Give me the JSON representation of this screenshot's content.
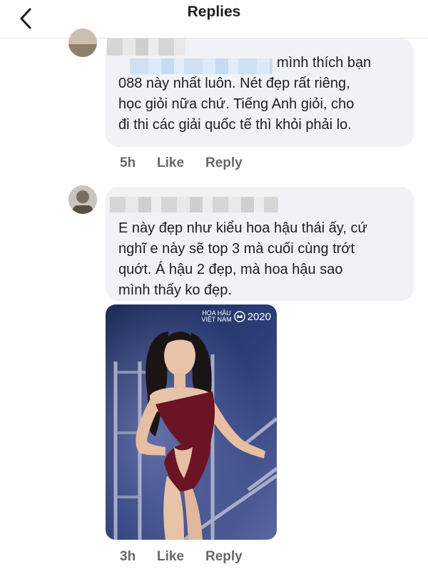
{
  "header": {
    "title": "Replies",
    "back_icon": "chevron-left-icon"
  },
  "comments": [
    {
      "author_visible": "",
      "text": " mình thích bạn\n088 này nhất luôn. Nét đẹp rất riêng,\nhọc giỏi nữa chứ. Tiếng Anh giỏi, cho\nđi thi các giải quốc tế thì khỏi phải lo.",
      "time": "5h",
      "like_label": "Like",
      "reply_label": "Reply"
    },
    {
      "author_visible": "",
      "text": "E này đẹp như kiểu hoa hậu thái ấy, cứ\nnghĩ e này sẽ top 3 mà cuối cùng trớt\nquớt. Á hậu 2 đẹp, mà hoa hậu sao\nmình thấy ko đẹp.",
      "time": "3h",
      "like_label": "Like",
      "reply_label": "Reply"
    }
  ],
  "photo": {
    "watermark_top": "HOA HẬU",
    "watermark_bottom": "VIỆT NAM",
    "watermark_year": "2020"
  },
  "colors": {
    "bubble": "#f0f2f5",
    "meta_text": "#65676b",
    "divider": "#e4e6eb"
  }
}
